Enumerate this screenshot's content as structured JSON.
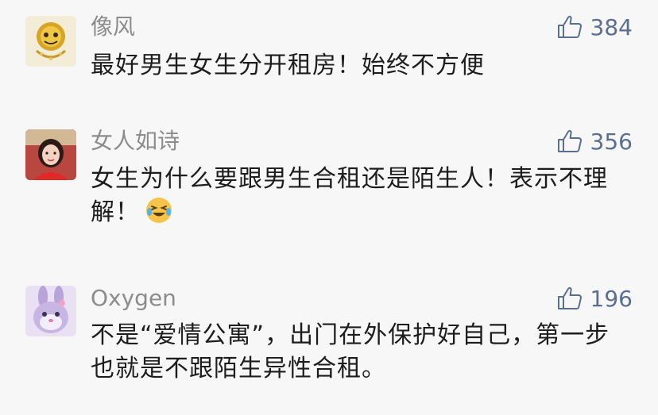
{
  "comments": [
    {
      "name": "像风",
      "likes": "384",
      "text": "最好男生女生分开租房！始终不方便"
    },
    {
      "name": "女人如诗",
      "likes": "356",
      "text": "女生为什么要跟男生合租还是陌生人！表示不理解！"
    },
    {
      "name": "Oxygen",
      "likes": "196",
      "text": "不是“爱情公寓”，出门在外保护好自己，第一步也就是不跟陌生异性合租。"
    }
  ],
  "colors": {
    "name": "#8c8c8c",
    "like": "#5a6f90",
    "text": "#1d1d1d",
    "background": "#f7f7f7"
  },
  "icons": [
    "thumbs-up-icon",
    "laughing-crying-emoji"
  ]
}
